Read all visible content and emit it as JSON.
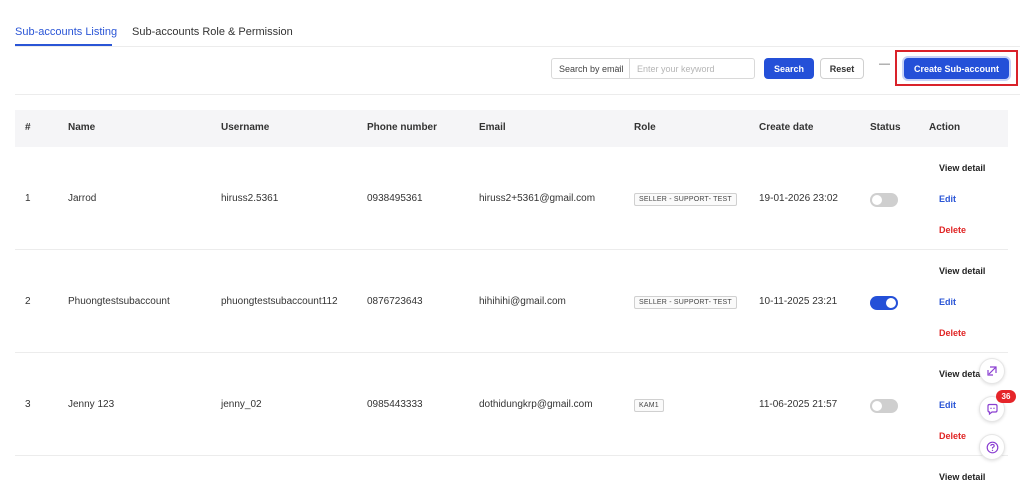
{
  "tabs": [
    {
      "label": "Sub-accounts Listing",
      "active": true
    },
    {
      "label": "Sub-accounts Role & Permission",
      "active": false
    }
  ],
  "toolbar": {
    "search_type": "Search by email",
    "keyword_placeholder": "Enter your keyword",
    "search_label": "Search",
    "reset_label": "Reset",
    "separator": "—",
    "create_label": "Create Sub-account"
  },
  "table": {
    "headers": [
      "#",
      "Name",
      "Username",
      "Phone number",
      "Email",
      "Role",
      "Create date",
      "Status",
      "Action"
    ],
    "actions": {
      "view": "View detail",
      "edit": "Edit",
      "delete": "Delete"
    },
    "rows": [
      {
        "index": "1",
        "name": "Jarrod",
        "username": "hiruss2.5361",
        "phone": "0938495361",
        "email": "hiruss2+5361@gmail.com",
        "role": "SELLER - SUPPORT- TEST",
        "create_date": "19-01-2026 23:02",
        "status_on": false
      },
      {
        "index": "2",
        "name": "Phuongtestsubaccount",
        "username": "phuongtestsubaccount112",
        "phone": "0876723643",
        "email": "hihihihi@gmail.com",
        "role": "SELLER - SUPPORT- TEST",
        "create_date": "10-11-2025 23:21",
        "status_on": true
      },
      {
        "index": "3",
        "name": "Jenny 123",
        "username": "jenny_02",
        "phone": "0985443333",
        "email": "dothidungkrp@gmail.com",
        "role": "KAM1",
        "create_date": "11-06-2025 21:57",
        "status_on": false
      }
    ],
    "partial_view_label": "View detail"
  },
  "floating": {
    "chat_badge": "36"
  },
  "colors": {
    "accent": "#2450d8",
    "danger": "#e02424",
    "highlight": "#d9222a"
  }
}
